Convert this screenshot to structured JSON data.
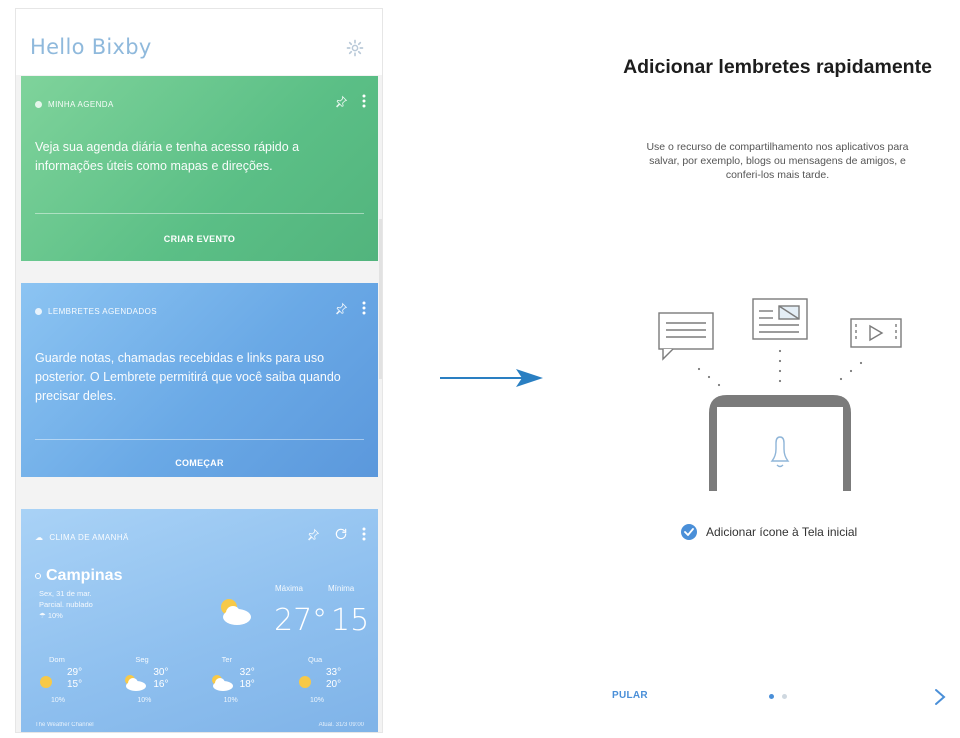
{
  "left": {
    "app_title": "Hello Bixby",
    "agenda": {
      "header": "MINHA AGENDA",
      "body": "Veja sua agenda diária e tenha acesso rápido a informações úteis como mapas e direções.",
      "action": "CRIAR EVENTO",
      "color": "#5bbf86"
    },
    "reminders": {
      "header": "LEMBRETES AGENDADOS",
      "body": "Guarde notas, chamadas recebidas e links para uso posterior. O Lembrete permitirá que você saiba quando precisar deles.",
      "action": "COMEÇAR",
      "color": "#6aa9e6"
    },
    "weather": {
      "header": "CLIMA DE AMANHÃ",
      "city": "Campinas",
      "date": "Sex, 31 de mar.",
      "condition": "Parcial. nublado",
      "rain": "10%",
      "max_label": "Máxima",
      "min_label": "Mínima",
      "max_temp": "27°",
      "min_temp": "15",
      "forecast": [
        {
          "day": "Dom",
          "hi": "29°",
          "lo": "15°",
          "rain": "10%",
          "icon": "sun-icon"
        },
        {
          "day": "Seg",
          "hi": "30°",
          "lo": "16°",
          "rain": "10%",
          "icon": "cloud-icon"
        },
        {
          "day": "Ter",
          "hi": "32°",
          "lo": "18°",
          "rain": "10%",
          "icon": "cloud-sun-icon"
        },
        {
          "day": "Qua",
          "hi": "33°",
          "lo": "20°",
          "rain": "10%",
          "icon": "sun-icon"
        }
      ],
      "footer_left": "The Weather Channel",
      "footer_right": "Atual. 31/3 09:00"
    }
  },
  "right": {
    "title": "Adicionar lembretes rapidamente",
    "description": "Use o recurso de compartilhamento nos aplicativos para salvar, por exemplo, blogs ou mensagens de amigos, e conferi-los mais tarde.",
    "checkbox_label": "Adicionar ícone à Tela inicial",
    "checkbox_checked": true,
    "skip_label": "PULAR",
    "page_index": 1,
    "page_count": 2,
    "accent": "#4a8fd8"
  }
}
